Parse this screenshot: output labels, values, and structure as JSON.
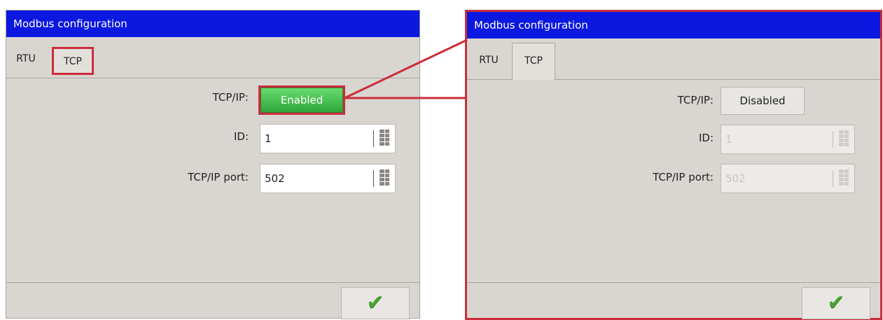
{
  "left_dialog": {
    "title": "Modbus configuration",
    "tabs": [
      {
        "label": "RTU"
      },
      {
        "label": "TCP"
      }
    ],
    "tcpip_label": "TCP/IP:",
    "tcpip_state": "Enabled",
    "id_label": "ID:",
    "id_value": "1",
    "port_label": "TCP/IP port:",
    "port_value": "502",
    "ok_icon": "check-icon"
  },
  "right_dialog": {
    "title": "Modbus configuration",
    "tabs": [
      {
        "label": "RTU"
      },
      {
        "label": "TCP"
      }
    ],
    "tcpip_label": "TCP/IP:",
    "tcpip_state": "Disabled",
    "id_label": "ID:",
    "id_value": "1",
    "port_label": "TCP/IP port:",
    "port_value": "502",
    "ok_icon": "check-icon"
  },
  "colors": {
    "titlebar": "#0b18e0",
    "highlight": "#cc2d3a",
    "enabled_green": "#3cba48",
    "check_green": "#4aa232"
  }
}
